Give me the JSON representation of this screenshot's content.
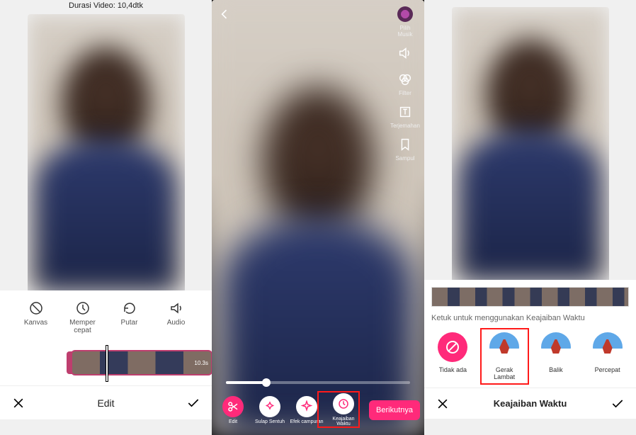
{
  "panel1": {
    "duration_label": "Durasi Video: 10,4dtk",
    "tools": [
      {
        "name": "kanvas",
        "label": "Kanvas"
      },
      {
        "name": "mempercepat",
        "label": "Memper\ncepat"
      },
      {
        "name": "putar",
        "label": "Putar"
      },
      {
        "name": "audio",
        "label": "Audio"
      }
    ],
    "timeline_duration_badge": "10.3s",
    "bottom_title": "Edit"
  },
  "panel2": {
    "sidebar": [
      {
        "name": "musik",
        "label": "Pilih\nMusik"
      },
      {
        "name": "volume",
        "label": ""
      },
      {
        "name": "filter",
        "label": "Filter"
      },
      {
        "name": "terjemahan",
        "label": "Terjemahan"
      },
      {
        "name": "sampul",
        "label": "Sampul"
      }
    ],
    "tools": [
      {
        "name": "edit",
        "label": "Edit"
      },
      {
        "name": "sulap-sentuh",
        "label": "Sulap Sentuh"
      },
      {
        "name": "efek-campuran",
        "label": "Efek campuran"
      },
      {
        "name": "keajaiban-waktu",
        "label": "Keajaiban Waktu"
      }
    ],
    "next_label": "Berikutnya"
  },
  "panel3": {
    "hint": "Ketuk untuk menggunakan Keajaiban Waktu",
    "options": [
      {
        "name": "tidak-ada",
        "label": "Tidak ada",
        "style": "none"
      },
      {
        "name": "gerak-lambat",
        "label": "Gerak Lambat",
        "style": "ski"
      },
      {
        "name": "balik",
        "label": "Balik",
        "style": "ski"
      },
      {
        "name": "percepat",
        "label": "Percepat",
        "style": "ski"
      }
    ],
    "bottom_title": "Keajaiban Waktu"
  }
}
